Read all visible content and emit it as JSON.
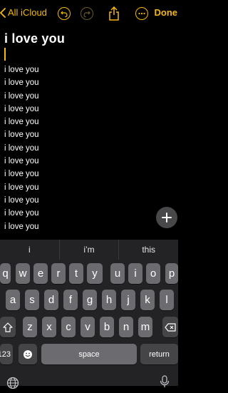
{
  "nav": {
    "back_label": "All iCloud",
    "done_label": "Done"
  },
  "note": {
    "title": "i love you",
    "lines": [
      "i love you",
      "i love you",
      "i love you",
      "i love you",
      "i love you",
      "i love you",
      "i love you",
      "i love you",
      "i love you",
      "i love you",
      "i love you",
      "i love you",
      "i love you"
    ]
  },
  "keyboard": {
    "suggestions": [
      "i",
      "i’m",
      "this"
    ],
    "row1": [
      "q",
      "w",
      "e",
      "r",
      "t",
      "y",
      "u",
      "i",
      "o",
      "p"
    ],
    "row2": [
      "a",
      "s",
      "d",
      "f",
      "g",
      "h",
      "j",
      "k",
      "l"
    ],
    "row3": [
      "z",
      "x",
      "c",
      "v",
      "b",
      "n",
      "m"
    ],
    "numbers_label": "123",
    "space_label": "space",
    "return_label": "return"
  },
  "colors": {
    "accent": "#f5b90c",
    "background": "#000000",
    "key": "#6c6c70"
  }
}
